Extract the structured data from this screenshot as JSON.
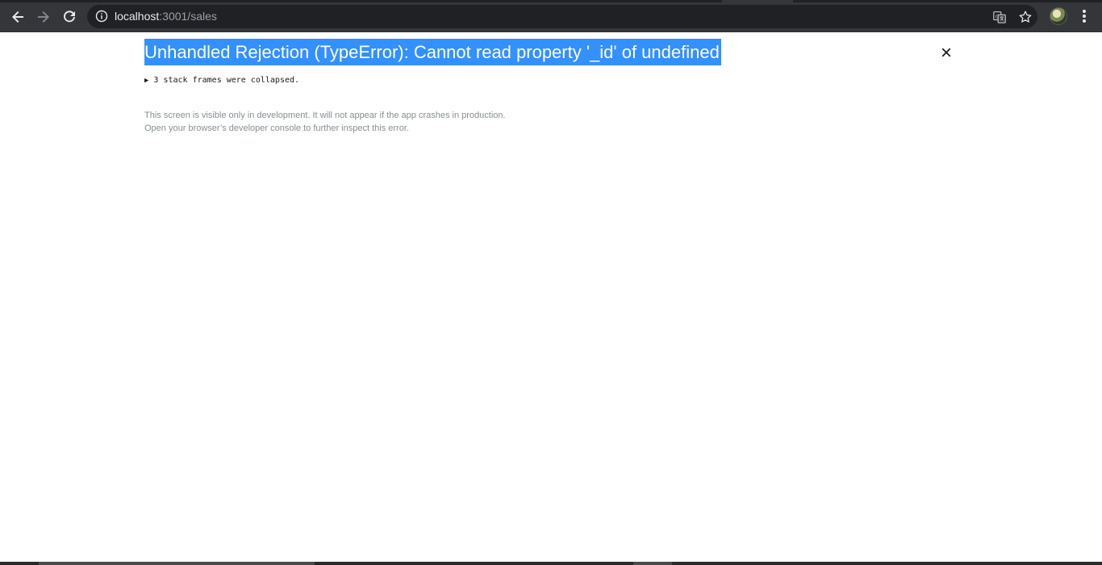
{
  "browser": {
    "url_host": "localhost",
    "url_rest": ":3001/sales",
    "icons": {
      "back": "back-arrow-icon",
      "forward": "forward-arrow-icon",
      "reload": "reload-icon",
      "site_info": "info-icon",
      "translate": "translate-icon",
      "bookmark": "star-icon",
      "profile": "avatar",
      "menu": "more-vert-icon"
    }
  },
  "error_overlay": {
    "title": "Unhandled Rejection (TypeError): Cannot read property '_id' of undefined",
    "stack_frames_toggle": "3 stack frames were collapsed.",
    "note_line1": "This screen is visible only in development. It will not appear if the app crashes in production.",
    "note_line2": "Open your browser’s developer console to further inspect this error.",
    "close_symbol": "×"
  },
  "colors": {
    "toolbar": "#35363a",
    "omnibox": "#202124",
    "title_highlight": "#3390ff",
    "note_text": "#878e91"
  }
}
